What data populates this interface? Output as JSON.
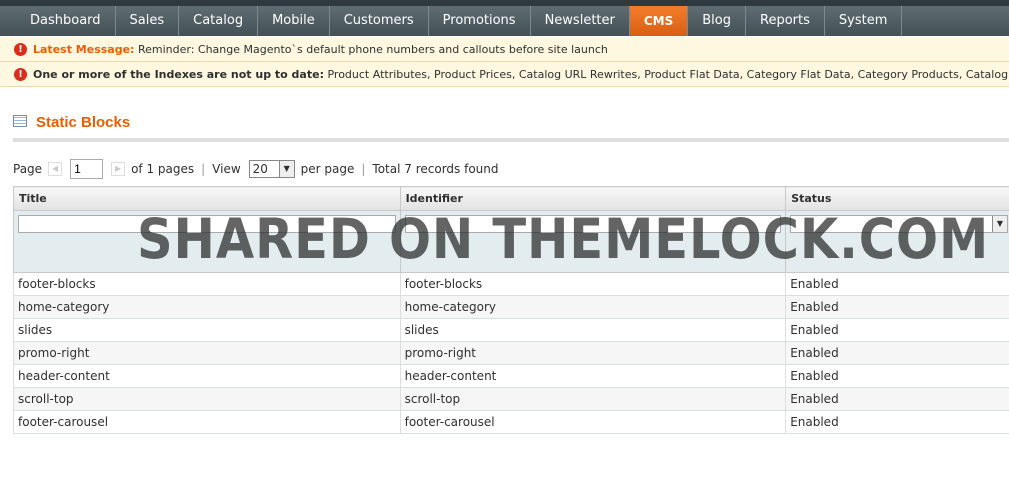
{
  "nav": {
    "items": [
      {
        "label": "Dashboard"
      },
      {
        "label": "Sales"
      },
      {
        "label": "Catalog"
      },
      {
        "label": "Mobile"
      },
      {
        "label": "Customers"
      },
      {
        "label": "Promotions"
      },
      {
        "label": "Newsletter"
      },
      {
        "label": "CMS"
      },
      {
        "label": "Blog"
      },
      {
        "label": "Reports"
      },
      {
        "label": "System"
      }
    ],
    "active_color": "#eb6f1f"
  },
  "messages": {
    "latest_label": "Latest Message:",
    "latest_text": "Reminder: Change Magento`s default phone numbers and callouts before site launch",
    "index_label": "One or more of the Indexes are not up to date:",
    "index_text": "Product Attributes, Product Prices, Catalog URL Rewrites, Product Flat Data, Category Flat Data, Category Products, Catalog Search Index, Stock Status"
  },
  "page": {
    "title": "Static Blocks",
    "title_color": "#eb5e00"
  },
  "pager": {
    "page_label": "Page",
    "page_value": "1",
    "of_pages": "of 1 pages",
    "view_label": "View",
    "per_page_value": "20",
    "per_page_label": "per page",
    "total": "Total 7 records found"
  },
  "grid": {
    "columns": [
      "Title",
      "Identifier",
      "Status"
    ],
    "rows": [
      {
        "title": "footer-blocks",
        "identifier": "footer-blocks",
        "status": "Enabled"
      },
      {
        "title": "home-category",
        "identifier": "home-category",
        "status": "Enabled"
      },
      {
        "title": "slides",
        "identifier": "slides",
        "status": "Enabled"
      },
      {
        "title": "promo-right",
        "identifier": "promo-right",
        "status": "Enabled"
      },
      {
        "title": "header-content",
        "identifier": "header-content",
        "status": "Enabled"
      },
      {
        "title": "scroll-top",
        "identifier": "scroll-top",
        "status": "Enabled"
      },
      {
        "title": "footer-carousel",
        "identifier": "footer-carousel",
        "status": "Enabled"
      }
    ]
  },
  "watermark": "SHARED ON THEMELOCK.COM"
}
